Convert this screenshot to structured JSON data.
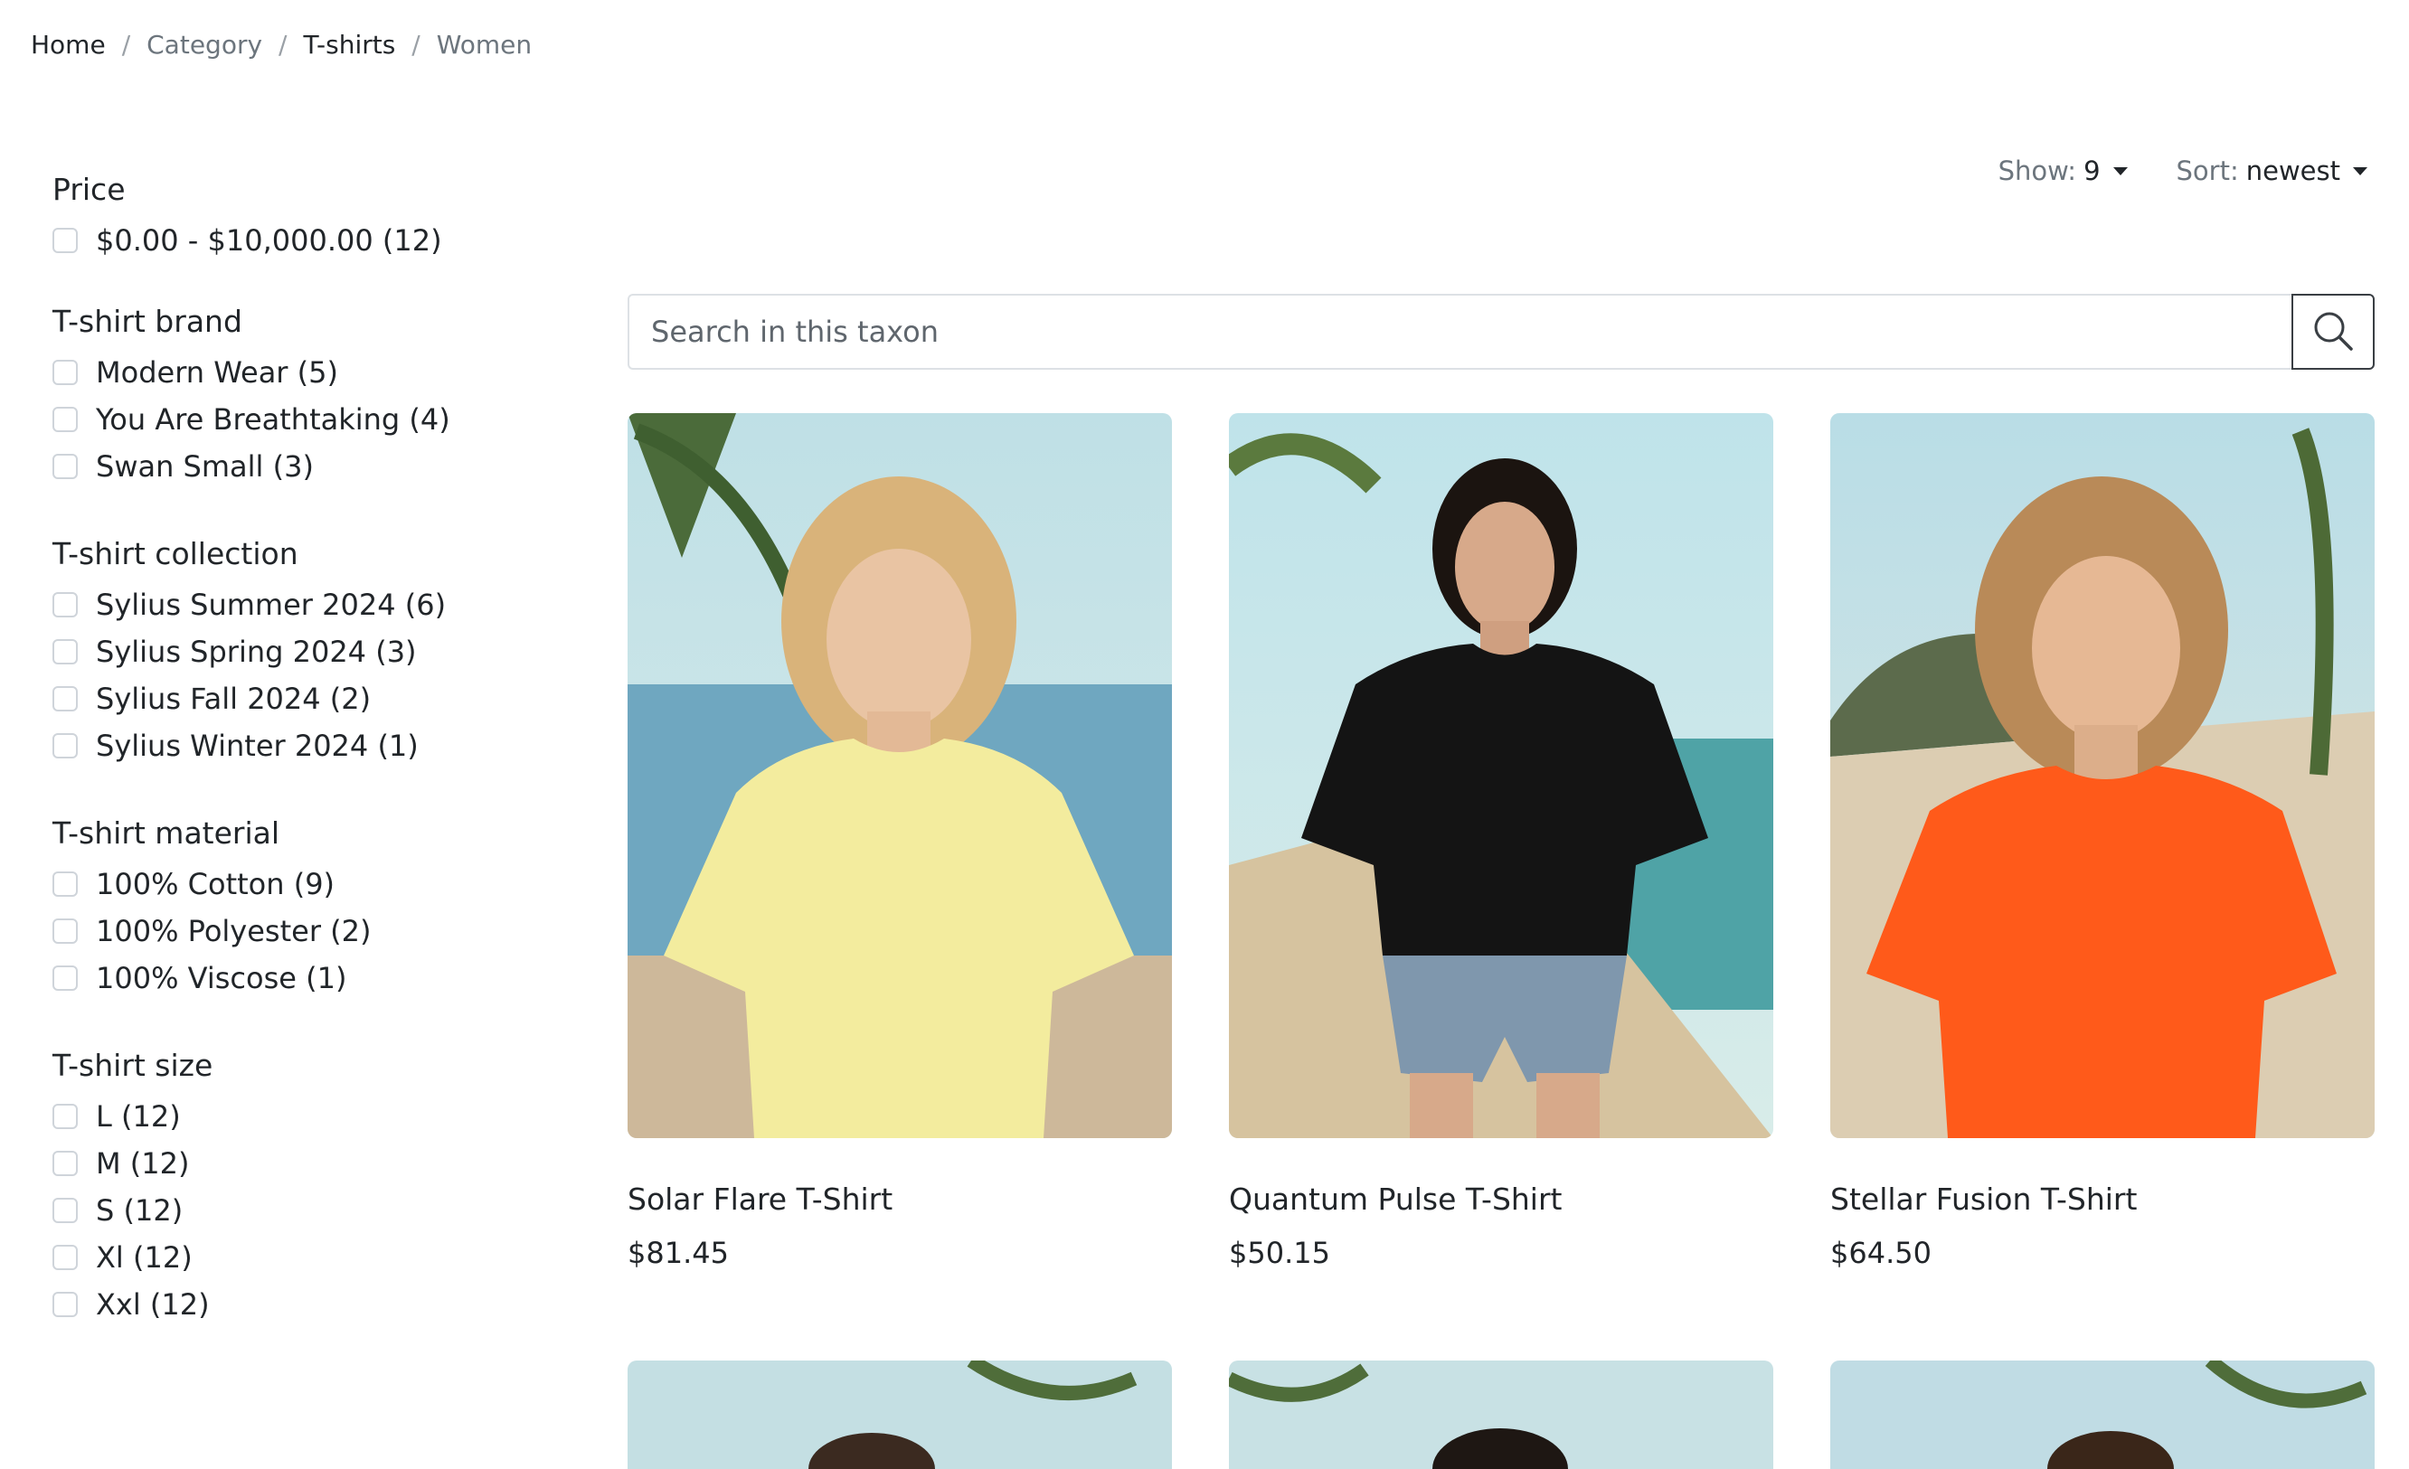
{
  "breadcrumb": [
    "Home",
    "Category",
    "T-shirts",
    "Women"
  ],
  "controls": {
    "show_label": "Show:",
    "show_value": "9",
    "sort_label": "Sort:",
    "sort_value": "newest"
  },
  "search": {
    "placeholder": "Search in this taxon"
  },
  "filters": {
    "price": {
      "title": "Price",
      "options": [
        "$0.00 - $10,000.00 (12)"
      ]
    },
    "brand": {
      "title": "T-shirt brand",
      "options": [
        "Modern Wear (5)",
        "You Are Breathtaking (4)",
        "Swan Small (3)"
      ]
    },
    "collection": {
      "title": "T-shirt collection",
      "options": [
        "Sylius Summer 2024 (6)",
        "Sylius Spring 2024 (3)",
        "Sylius Fall 2024 (2)",
        "Sylius Winter 2024 (1)"
      ]
    },
    "material": {
      "title": "T-shirt material",
      "options": [
        "100% Cotton (9)",
        "100% Polyester (2)",
        "100% Viscose (1)"
      ]
    },
    "size": {
      "title": "T-shirt size",
      "options": [
        "L (12)",
        "M (12)",
        "S (12)",
        "Xl (12)",
        "Xxl (12)"
      ]
    }
  },
  "products": [
    {
      "name": "Solar Flare T-Shirt",
      "price": "$81.45",
      "shirt_color": "#f3ec9e"
    },
    {
      "name": "Quantum Pulse T-Shirt",
      "price": "$50.15",
      "shirt_color": "#141414"
    },
    {
      "name": "Stellar Fusion T-Shirt",
      "price": "$64.50",
      "shirt_color": "#ff5a1a"
    }
  ]
}
